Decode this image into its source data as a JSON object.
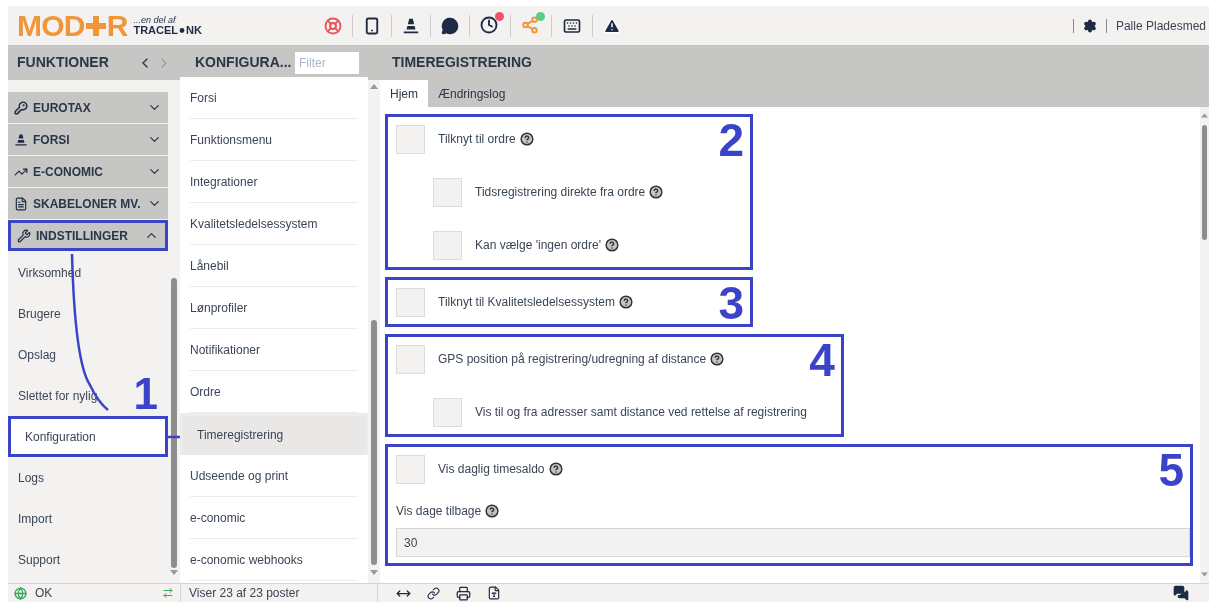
{
  "header": {
    "logo_left": "MOD",
    "logo_right": "R",
    "tagline": "...en del af",
    "brand_left": "TRACEL",
    "brand_right": "NK",
    "user": "Palle Pladesmed"
  },
  "toolbar": {
    "nav_title": "FUNKTIONER",
    "list_title": "KONFIGURA...",
    "filter_placeholder": "Filter",
    "content_title": "TIMEREGISTRERING"
  },
  "sidebar": {
    "groups": [
      {
        "kind": "key",
        "label": "EUROTAX",
        "expanded": false,
        "annotated": false
      },
      {
        "kind": "cone",
        "label": "FORSI",
        "expanded": false,
        "annotated": false
      },
      {
        "kind": "chart",
        "label": "E-CONOMIC",
        "expanded": false,
        "annotated": false
      },
      {
        "kind": "template",
        "label": "SKABELONER MV.",
        "expanded": false,
        "annotated": false
      },
      {
        "kind": "tools",
        "label": "INDSTILLINGER",
        "expanded": true,
        "annotated": true
      }
    ],
    "items": [
      {
        "label": "Virksomhed",
        "selected": false,
        "annotated": false
      },
      {
        "label": "Brugere",
        "selected": false,
        "annotated": false
      },
      {
        "label": "Opslag",
        "selected": false,
        "annotated": false
      },
      {
        "label": "Slettet for nylig",
        "selected": false,
        "annotated": false
      },
      {
        "label": "Konfiguration",
        "selected": true,
        "annotated": true,
        "annotation_number": "1"
      },
      {
        "label": "Logs",
        "selected": false,
        "annotated": false
      },
      {
        "label": "Import",
        "selected": false,
        "annotated": false
      },
      {
        "label": "Support",
        "selected": false,
        "annotated": false
      }
    ]
  },
  "list": [
    {
      "label": "Forsi",
      "selected": false,
      "annotated": false
    },
    {
      "label": "Funktionsmenu",
      "selected": false,
      "annotated": false
    },
    {
      "label": "Integrationer",
      "selected": false,
      "annotated": false
    },
    {
      "label": "Kvalitetsledelsessystem",
      "selected": false,
      "annotated": false
    },
    {
      "label": "Lånebil",
      "selected": false,
      "annotated": false
    },
    {
      "label": "Lønprofiler",
      "selected": false,
      "annotated": false
    },
    {
      "label": "Notifikationer",
      "selected": false,
      "annotated": false
    },
    {
      "label": "Ordre",
      "selected": false,
      "annotated": false
    },
    {
      "label": "Timeregistrering",
      "selected": true,
      "annotated": true
    },
    {
      "label": "Udseende og print",
      "selected": false,
      "annotated": false
    },
    {
      "label": "e-conomic",
      "selected": false,
      "annotated": false
    },
    {
      "label": "e-conomic webhooks",
      "selected": false,
      "annotated": false
    }
  ],
  "tabs": [
    {
      "label": "Hjem",
      "selected": true
    },
    {
      "label": "Ændringslog",
      "selected": false
    }
  ],
  "sections": [
    {
      "annotation_number": "2",
      "full_width": false,
      "rows": [
        {
          "kind": "checkbox",
          "label": "Tilknyt til ordre",
          "checked": false,
          "help": true,
          "children": [
            {
              "kind": "checkbox",
              "label": "Tidsregistrering direkte fra ordre",
              "checked": false,
              "help": true
            },
            {
              "kind": "checkbox",
              "label": "Kan vælge 'ingen ordre'",
              "checked": false,
              "help": true
            }
          ]
        }
      ]
    },
    {
      "annotation_number": "3",
      "full_width": false,
      "rows": [
        {
          "kind": "checkbox",
          "label": "Tilknyt til Kvalitetsledelsessystem",
          "checked": false,
          "help": true
        }
      ]
    },
    {
      "annotation_number": "4",
      "full_width": false,
      "rows": [
        {
          "kind": "checkbox",
          "label": "GPS position på registrering/udregning af distance",
          "checked": false,
          "help": true,
          "children": [
            {
              "kind": "checkbox",
              "label": "Vis til og fra adresser samt distance ved rettelse af registrering",
              "checked": false,
              "help": false
            }
          ]
        }
      ]
    },
    {
      "annotation_number": "5",
      "full_width": true,
      "rows": [
        {
          "kind": "checkbox",
          "label": "Vis daglig timesaldo",
          "checked": false,
          "help": true
        },
        {
          "kind": "number_field",
          "label": "Vis dage tilbage",
          "value": "30",
          "help": true
        }
      ]
    }
  ],
  "status_bar": {
    "status": "OK",
    "count": "Viser 23 af 23 poster"
  }
}
